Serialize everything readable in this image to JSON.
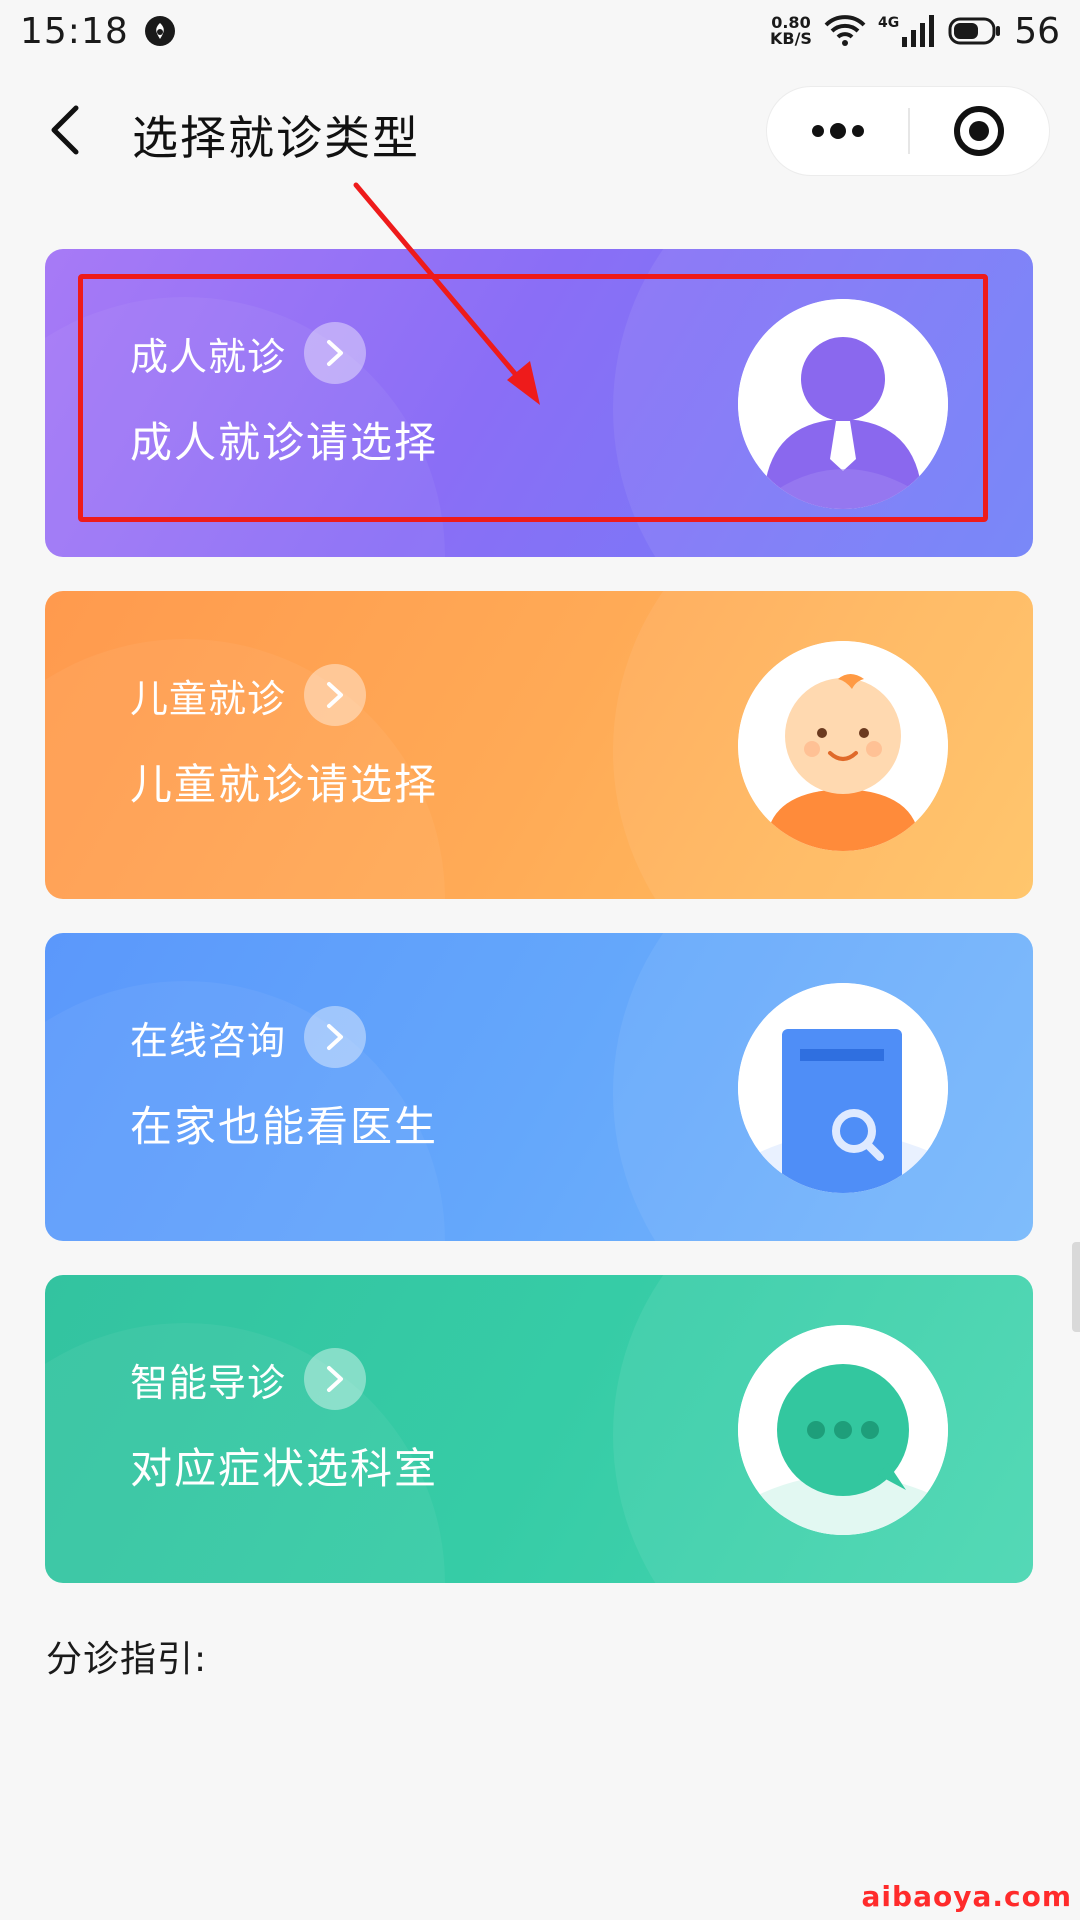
{
  "status_bar": {
    "time": "15:18",
    "speed_value": "0.80",
    "speed_unit": "KB/S",
    "network": "4G",
    "battery": "56"
  },
  "nav": {
    "title": "选择就诊类型"
  },
  "cards": [
    {
      "title": "成人就诊",
      "subtitle": "成人就诊请选择",
      "icon": "adult-avatar-icon",
      "color": "#8a6ef6"
    },
    {
      "title": "儿童就诊",
      "subtitle": "儿童就诊请选择",
      "icon": "child-avatar-icon",
      "color": "#ffaa56"
    },
    {
      "title": "在线咨询",
      "subtitle": "在家也能看医生",
      "icon": "document-search-icon",
      "color": "#64a7fb"
    },
    {
      "title": "智能导诊",
      "subtitle": "对应症状选科室",
      "icon": "chat-bubble-icon",
      "color": "#36cca6"
    }
  ],
  "guide": {
    "label": "分诊指引:"
  },
  "watermark": "aibaoya.com",
  "colors": {
    "highlight": "#ee1b1b"
  }
}
